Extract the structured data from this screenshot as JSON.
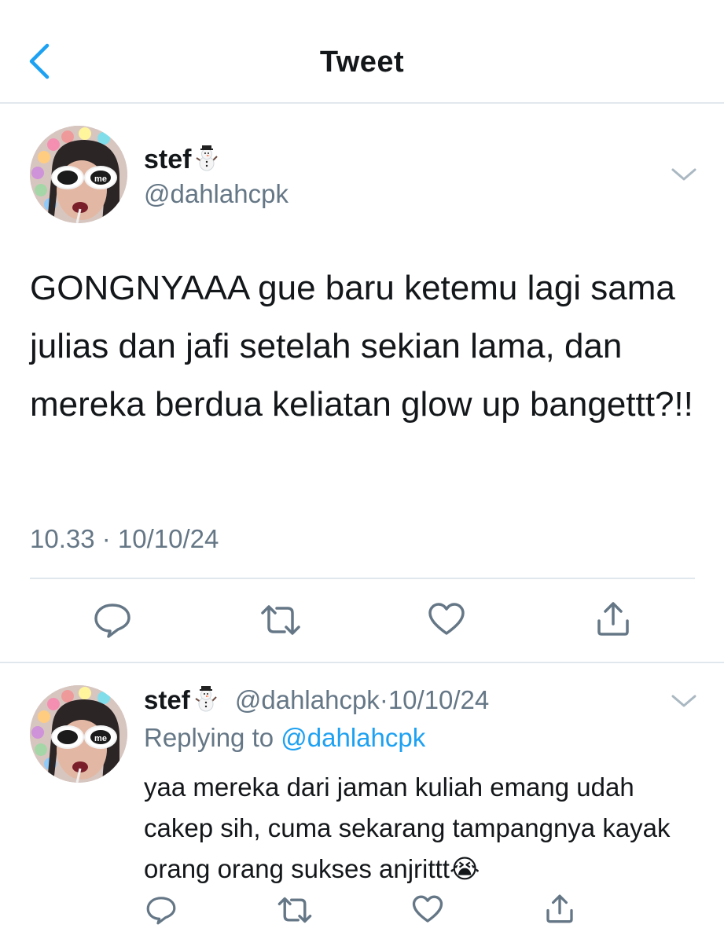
{
  "header": {
    "title": "Tweet",
    "back_icon": "chevron-left-icon"
  },
  "main_tweet": {
    "display_name": "stef",
    "name_emoji": "☃️",
    "handle": "@dahlahcpk",
    "avatar_badge": "me",
    "text": "GONGNYAAA gue baru ketemu lagi sama julias dan jafi setelah sekian lama, dan mereka berdua keliatan glow up bangettt?!!",
    "timestamp": "10.33 · 10/10/24",
    "actions": [
      "reply-icon",
      "retweet-icon",
      "like-icon",
      "share-icon"
    ]
  },
  "reply_tweet": {
    "display_name": "stef",
    "name_emoji": "☃️",
    "handle": "@dahlahcpk",
    "separator": "·",
    "date": "10/10/24",
    "replying_label": "Replying to",
    "replying_to": "@dahlahcpk",
    "avatar_badge": "me",
    "text": "yaa mereka dari jaman kuliah emang udah cakep sih, cuma sekarang tampangnya kayak orang orang sukses anjrittt😭"
  },
  "colors": {
    "accent": "#1da1f2",
    "text_primary": "#14171a",
    "text_secondary": "#657786",
    "divider": "#e1e8ed",
    "icon_gray": "#657786"
  }
}
